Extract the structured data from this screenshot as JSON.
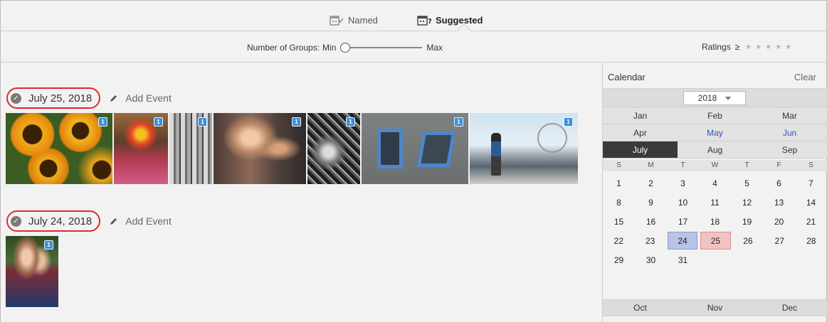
{
  "tabs": {
    "named_label": "Named",
    "suggested_label": "Suggested"
  },
  "toolbar": {
    "groups_label": "Number of Groups:",
    "min_label": "Min",
    "max_label": "Max",
    "groups_slider_value": 0,
    "ratings_label": "Ratings",
    "ratings_operator": "≥",
    "ratings_stars": 5
  },
  "groups": [
    {
      "date": "July 25, 2018",
      "add_event": "Add Event",
      "photo_count": 7
    },
    {
      "date": "July 24, 2018",
      "add_event": "Add Event",
      "photo_count": 1
    }
  ],
  "photo_badge": "1",
  "calendar": {
    "title": "Calendar",
    "clear_label": "Clear",
    "year": "2018",
    "month_rows": [
      [
        "Jan",
        "Feb",
        "Mar"
      ],
      [
        "Apr",
        "May",
        "Jun"
      ],
      [
        "July",
        "Aug",
        "Sep"
      ]
    ],
    "bottom_months": [
      "Oct",
      "Nov",
      "Dec"
    ],
    "selected_month": "July",
    "highlighted_months": [
      "May",
      "Jun"
    ],
    "weekdays": [
      "S",
      "M",
      "T",
      "W",
      "T",
      "F",
      "S"
    ],
    "weeks": [
      [
        "1",
        "2",
        "3",
        "4",
        "5",
        "6",
        "7"
      ],
      [
        "8",
        "9",
        "10",
        "11",
        "12",
        "13",
        "14"
      ],
      [
        "15",
        "16",
        "17",
        "18",
        "19",
        "20",
        "21"
      ],
      [
        "22",
        "23",
        "24",
        "25",
        "26",
        "27",
        "28"
      ],
      [
        "29",
        "30",
        "31",
        "",
        "",
        "",
        ""
      ]
    ],
    "highlight_blue_day": "24",
    "highlight_red_day": "25"
  },
  "colors": {
    "annotation_red": "#e02a2a",
    "badge_blue": "#3f8fd8",
    "month_blue": "#2f54c4"
  }
}
